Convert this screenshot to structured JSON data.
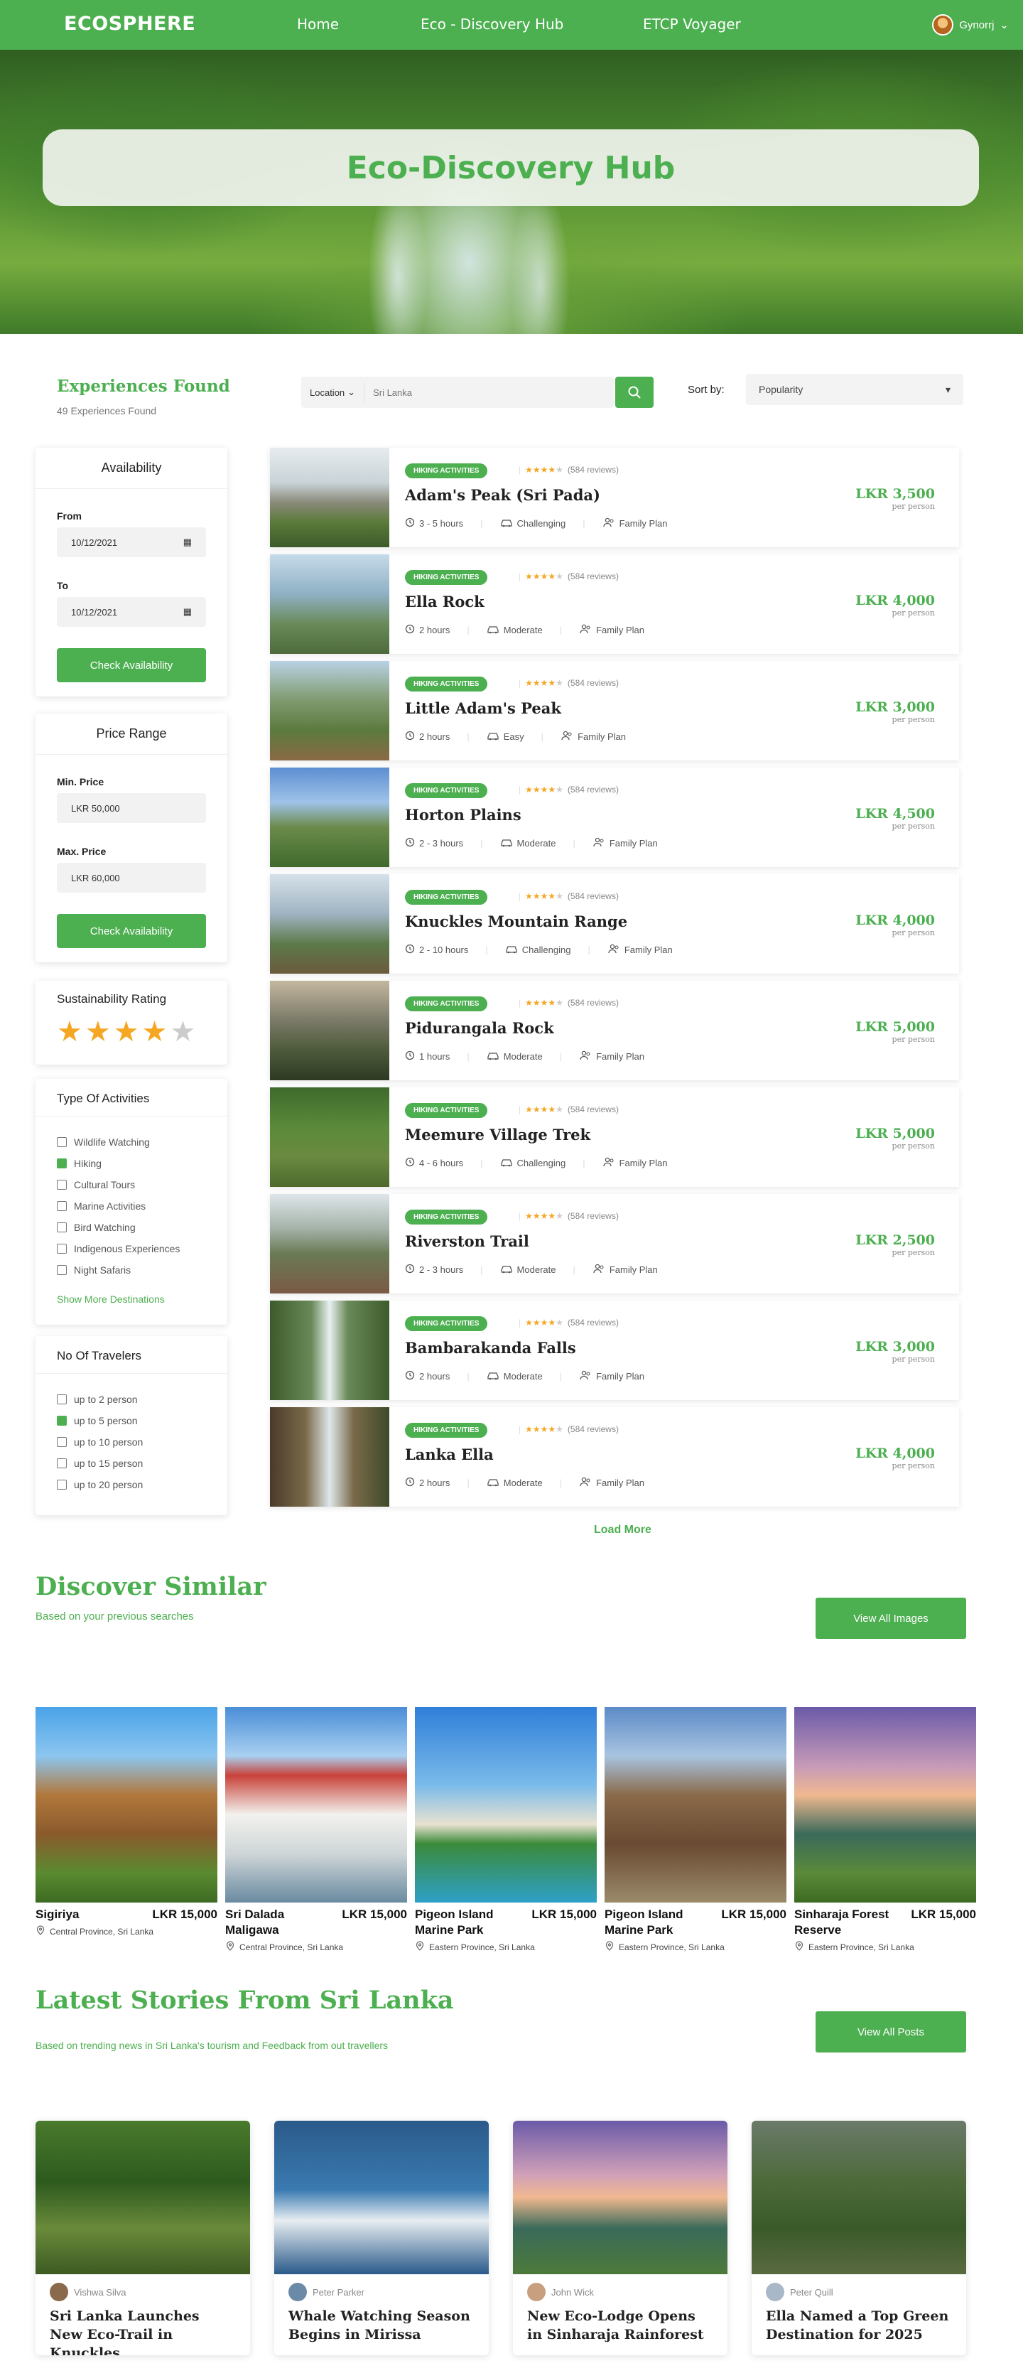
{
  "nav": {
    "logo": "ECOSPHERE",
    "links": [
      "Home",
      "Eco - Discovery Hub",
      "ETCP Voyager"
    ],
    "user": "Gynorrj"
  },
  "hero": {
    "title": "Eco-Discovery Hub"
  },
  "results": {
    "title": "Experiences Found",
    "count_text": "49 Experiences Found"
  },
  "search": {
    "location_label": "Location",
    "placeholder": "Sri Lanka"
  },
  "sort": {
    "label": "Sort by:",
    "value": "Popularity"
  },
  "availability": {
    "title": "Availability",
    "from_label": "From",
    "from_value": "10/12/2021",
    "to_label": "To",
    "to_value": "10/12/2021",
    "button": "Check Availability"
  },
  "price_range": {
    "title": "Price Range",
    "min_label": "Min. Price",
    "min_value": "LKR 50,000",
    "max_label": "Max. Price",
    "max_value": "LKR 60,000",
    "button": "Check Availability"
  },
  "sustainability": {
    "title": "Sustainability Rating",
    "rating": 4,
    "max": 5
  },
  "activities": {
    "title": "Type Of Activities",
    "items": [
      {
        "label": "Wildlife Watching",
        "checked": false
      },
      {
        "label": "Hiking",
        "checked": true
      },
      {
        "label": "Cultural Tours",
        "checked": false
      },
      {
        "label": "Marine Activities",
        "checked": false
      },
      {
        "label": "Bird Watching",
        "checked": false
      },
      {
        "label": "Indigenous Experiences",
        "checked": false
      },
      {
        "label": "Night Safaris",
        "checked": false
      }
    ],
    "more": "Show More Destinations"
  },
  "travelers": {
    "title": "No Of Travelers",
    "items": [
      {
        "label": "up to 2 person",
        "checked": false
      },
      {
        "label": "up to 5 person",
        "checked": true
      },
      {
        "label": "up to 10 person",
        "checked": false
      },
      {
        "label": "up to 15 person",
        "checked": false
      },
      {
        "label": "up to 20 person",
        "checked": false
      }
    ]
  },
  "listing_common": {
    "badge": "HIKING ACTIVITIES",
    "reviews": "(584 reviews)",
    "rating": 4,
    "plan": "Family Plan",
    "per": "per person"
  },
  "listings": [
    {
      "name": "Adam's Peak (Sri Pada)",
      "duration": "3 - 5 hours",
      "level": "Challenging",
      "price": "LKR 3,500"
    },
    {
      "name": "Ella Rock",
      "duration": "2 hours",
      "level": "Moderate",
      "price": "LKR 4,000"
    },
    {
      "name": "Little Adam's Peak",
      "duration": "2 hours",
      "level": "Easy",
      "price": "LKR 3,000"
    },
    {
      "name": "Horton Plains",
      "duration": "2 - 3 hours",
      "level": "Moderate",
      "price": "LKR 4,500"
    },
    {
      "name": "Knuckles Mountain Range",
      "duration": "2 - 10 hours",
      "level": "Challenging",
      "price": "LKR 4,000"
    },
    {
      "name": "Pidurangala Rock",
      "duration": "1 hours",
      "level": "Moderate",
      "price": "LKR 5,000"
    },
    {
      "name": "Meemure Village Trek",
      "duration": "4 - 6 hours",
      "level": "Challenging",
      "price": "LKR 5,000"
    },
    {
      "name": "Riverston Trail",
      "duration": "2 - 3 hours",
      "level": "Moderate",
      "price": "LKR 2,500"
    },
    {
      "name": "Bambarakanda Falls",
      "duration": "2 hours",
      "level": "Moderate",
      "price": "LKR 3,000"
    },
    {
      "name": "Lanka Ella",
      "duration": "2 hours",
      "level": "Moderate",
      "price": "LKR 4,000"
    }
  ],
  "load_more": "Load More",
  "discover": {
    "title": "Discover Similar",
    "subtitle": "Based on your previous searches",
    "button": "View All Images",
    "items": [
      {
        "name": "Sigiriya",
        "price": "LKR 15,000",
        "location": "Central Province, Sri Lanka"
      },
      {
        "name": "Sri Dalada Maligawa",
        "price": "LKR 15,000",
        "location": "Central Province, Sri Lanka"
      },
      {
        "name": "Pigeon Island Marine Park",
        "price": "LKR 15,000",
        "location": "Eastern Province, Sri Lanka"
      },
      {
        "name": "Pigeon Island Marine Park",
        "price": "LKR 15,000",
        "location": "Eastern Province, Sri Lanka"
      },
      {
        "name": "Sinharaja Forest Reserve",
        "price": "LKR 15,000",
        "location": "Eastern Province, Sri Lanka"
      }
    ]
  },
  "stories": {
    "title": "Latest Stories From Sri Lanka",
    "subtitle": "Based on trending news in Sri Lanka's tourism and Feedback from out travellers",
    "button": "View All Posts",
    "items": [
      {
        "author": "Vishwa Silva",
        "title": "Sri Lanka Launches New Eco-Trail in Knuckles"
      },
      {
        "author": "Peter Parker",
        "title": "Whale Watching Season Begins in Mirissa"
      },
      {
        "author": "John Wick",
        "title": "New Eco-Lodge Opens in Sinharaja Rainforest"
      },
      {
        "author": "Peter Quill",
        "title": "Ella Named a Top Green Destination for 2025"
      }
    ]
  },
  "colors": {
    "accent": "#4caf50",
    "star": "#f5a623"
  }
}
